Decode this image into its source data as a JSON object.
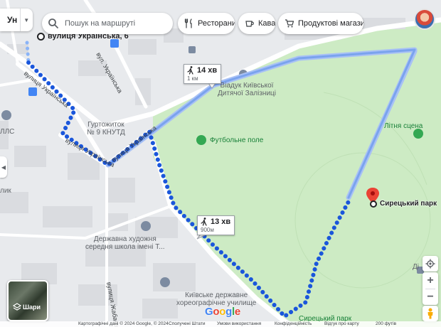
{
  "toolbar": {
    "travel_mode": "Ун",
    "search_placeholder": "Пошук на маршруті",
    "chips": [
      {
        "label": "Ресторани",
        "icon": "restaurant-icon"
      },
      {
        "label": "Кава",
        "icon": "coffee-icon"
      },
      {
        "label": "Продуктові магазини",
        "icon": "cart-icon"
      }
    ]
  },
  "route": {
    "origin": "вулиця Українська, 6",
    "destination": "Сирецький парк",
    "alt_duration": "14 хв",
    "alt_distance": "1 км",
    "main_duration": "13 хв",
    "main_distance": "900м",
    "main_color": "#1a56db",
    "alt_color": "#8ab4f8"
  },
  "map_labels": {
    "street_ukrainska_1": "вулиця Українська",
    "street_ukrainska_2": "вулиця Українська",
    "street_ukrainska_3": "вулиця Українська",
    "street_ukrainska_4": "вул. Українська",
    "street_zhabaieva": "вулиця Жабаєва",
    "dorm_line1": "Гуртожиток",
    "dorm_line2": "№ 9 КНУТД",
    "viaduct_line1": "Віадук Київської",
    "viaduct_line2": "Дитячої Залізниці",
    "football": "Футбольне поле",
    "summer_stage": "Літня сцена",
    "art_school_line1": "Державна художня",
    "art_school_line2": "середня школа імені Т...",
    "choreo_line1": "Київське державне",
    "choreo_line2": "хореографічне училище",
    "park_bottom": "Сирецький парк",
    "edge_pls": "ЛЛС",
    "edge_lyk": "лик",
    "edge_di": "Ді"
  },
  "layers": {
    "label": "Шари"
  },
  "controls": {
    "zoom_in": "+",
    "zoom_out": "−"
  },
  "footer": {
    "map_data": "Картографічні дані © 2024 Google, © 2024",
    "country": "Сполучені Штати",
    "terms": "Умови використання",
    "privacy": "Конфіденційність",
    "feedback": "Відгук про карту",
    "scale": "200 футів"
  },
  "colors": {
    "park": "#cdebc4",
    "land": "#e8eaed",
    "building": "#dadce0",
    "road": "#ffffff"
  }
}
